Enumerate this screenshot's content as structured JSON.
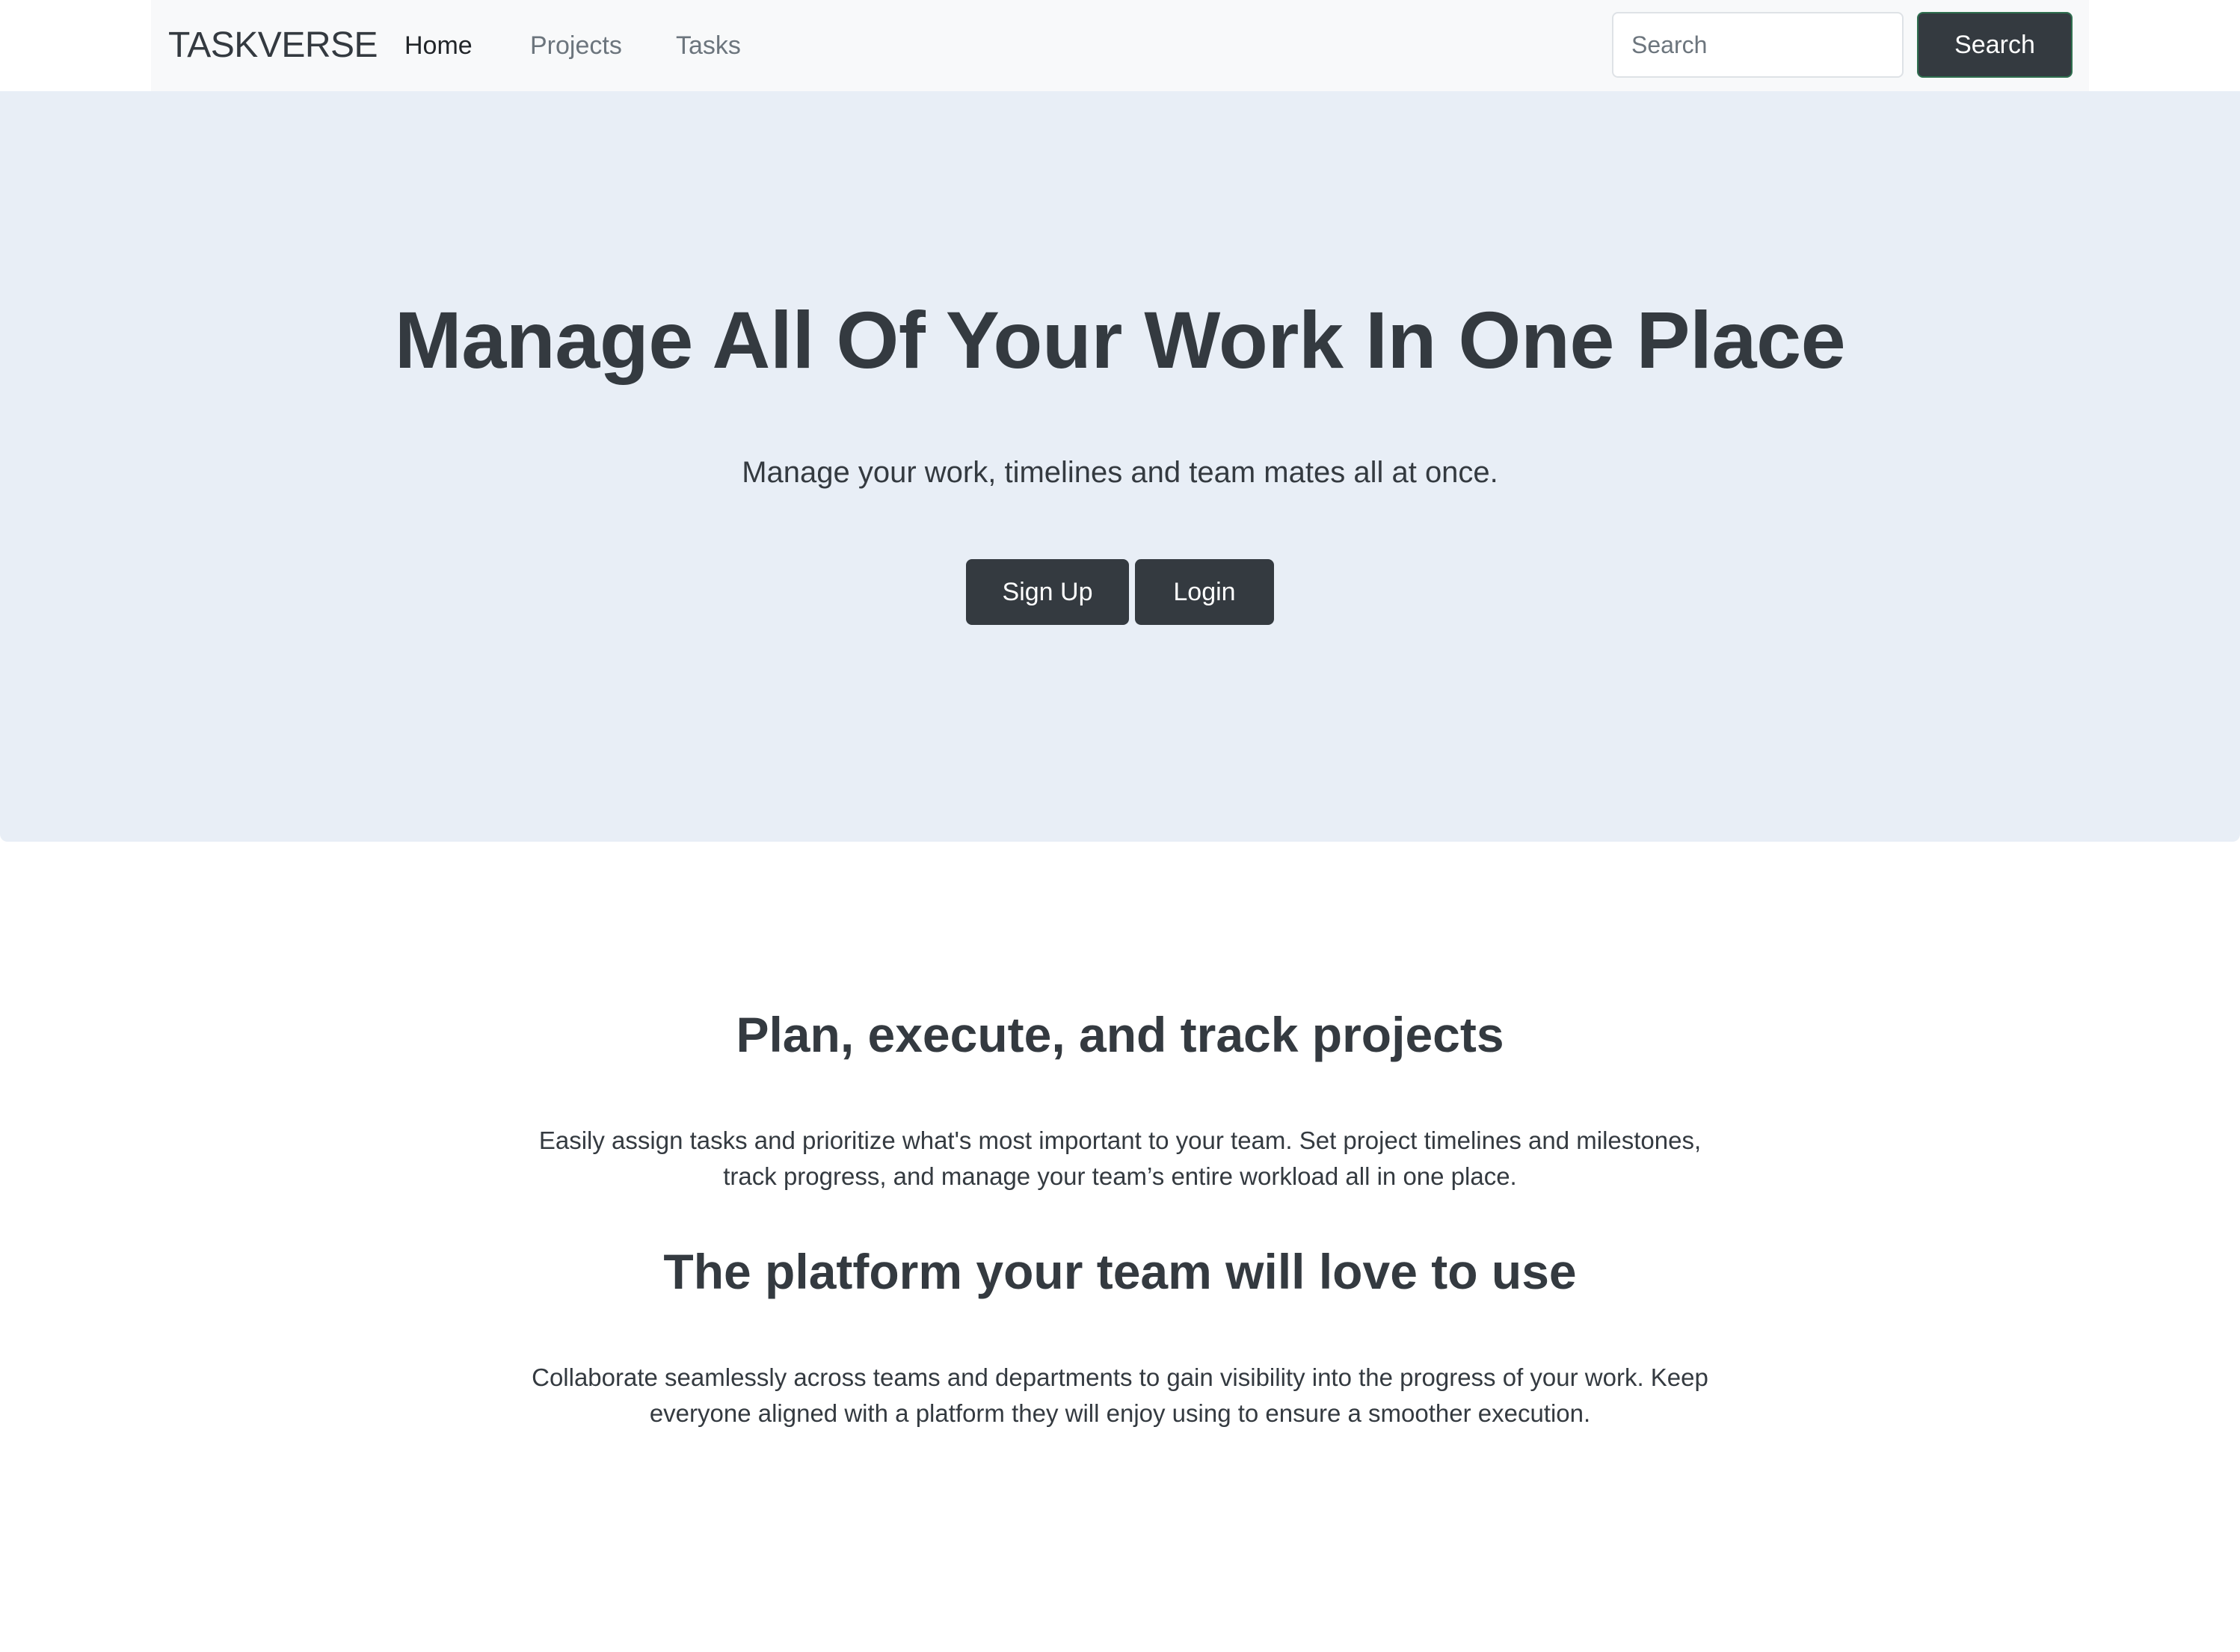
{
  "navbar": {
    "brand": "TASKVERSE",
    "links": [
      {
        "label": "Home",
        "active": true
      },
      {
        "label": "Projects",
        "active": false
      },
      {
        "label": "Tasks",
        "active": false
      }
    ],
    "search": {
      "placeholder": "Search",
      "button_label": "Search"
    }
  },
  "hero": {
    "title": "Manage All Of Your Work In One Place",
    "subtitle": "Manage your work, timelines and team mates all at once.",
    "buttons": {
      "signup_label": "Sign Up",
      "login_label": "Login"
    }
  },
  "features": [
    {
      "title": "Plan, execute, and track projects",
      "text": "Easily assign tasks and prioritize what's most important to your team. Set project timelines and milestones, track progress, and manage your team’s entire workload all in one place."
    },
    {
      "title": "The platform your team will love to use",
      "text": "Collaborate seamlessly across teams and departments to gain visibility into the progress of your work. Keep everyone aligned with a platform they will enjoy using to ensure a smoother execution."
    }
  ],
  "colors": {
    "navbar_bg": "#f8f9fa",
    "hero_bg": "#e8eef6",
    "dark_button": "#343a40",
    "text": "#343a40"
  }
}
